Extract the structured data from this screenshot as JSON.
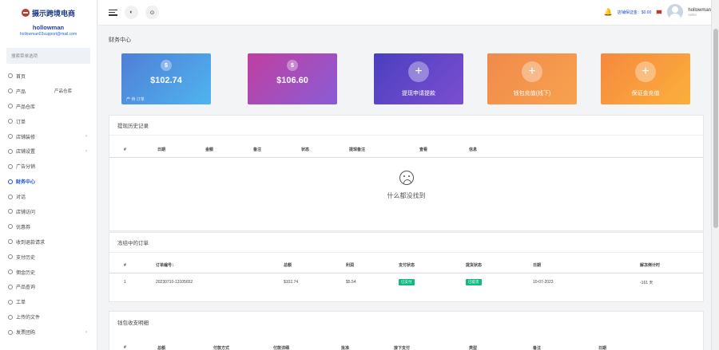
{
  "brand": {
    "logo_text": "摄示跨境电商"
  },
  "user": {
    "name": "hollowman",
    "email": "hollowman03support@mail.com",
    "role": "seller"
  },
  "search": {
    "placeholder": "搜索菜单选项"
  },
  "menu": [
    {
      "label": "首页"
    },
    {
      "label": "产品",
      "extra": "产品仓库"
    },
    {
      "label": "产品仓库"
    },
    {
      "label": "订单"
    },
    {
      "label": "店铺装修",
      "chevron": "›"
    },
    {
      "label": "店铺设置",
      "chevron": "›"
    },
    {
      "label": "广告分销"
    },
    {
      "label": "财务中心",
      "active": true
    },
    {
      "label": "对话"
    },
    {
      "label": "店铺访问"
    },
    {
      "label": "优惠券"
    },
    {
      "label": "收到退款请求"
    },
    {
      "label": "支付历史"
    },
    {
      "label": "佣金历史"
    },
    {
      "label": "产品查询"
    },
    {
      "label": "工单"
    },
    {
      "label": "上传的文件"
    },
    {
      "label": "发票团购",
      "chevron": "›"
    }
  ],
  "topbar": {
    "btn1": "◐",
    "btn2": "⊙",
    "bell": "🔔",
    "balance_label": "店铺保证金：$0.00"
  },
  "page": {
    "title": "财务中心"
  },
  "cards": [
    {
      "type": "coin",
      "icon": "$",
      "amount": "$102.74",
      "sub": "产   待 订单",
      "color1": "#4f7fd6",
      "color2": "#4fb4ef"
    },
    {
      "type": "coin",
      "icon": "$",
      "amount": "$106.60",
      "label": "",
      "color1": "#c03fa0",
      "color2": "#8a5cd6"
    },
    {
      "type": "plus",
      "icon": "+",
      "label": "提现申请提款",
      "color1": "#4a3fc0",
      "color2": "#7b4fd0"
    },
    {
      "type": "plus",
      "icon": "+",
      "label": "钱包充值(线下)",
      "color1": "#f08a4b",
      "color2": "#f7a24f"
    },
    {
      "type": "plus",
      "icon": "+",
      "label": "保证金充值",
      "color1": "#f6883f",
      "color2": "#fbb03b"
    }
  ],
  "withdraw": {
    "title": "提现历史记录",
    "headers": [
      "#",
      "日期",
      "金额",
      "备注",
      "状态",
      "提现备注",
      "查看",
      "信息"
    ],
    "empty": "什么都没找到"
  },
  "pending": {
    "title": "冻结中的订单",
    "headers": [
      "#",
      "订单编号：",
      "总额",
      "利润",
      "支付状态",
      "提货状态",
      "日期",
      "解冻倒计时"
    ],
    "rows": [
      {
        "idx": "1",
        "order_no": "20230710-13105652",
        "total": "$102.74",
        "profit": "$5.54",
        "pay_status": "已支付",
        "pick_status": "已提货",
        "date": "10-07-2023",
        "countdown": "-161 天"
      }
    ]
  },
  "wallet": {
    "title": "钱包收支明细",
    "headers": [
      "#",
      "总额",
      "付款方式",
      "付款详细",
      "批准",
      "接下支付",
      "类型",
      "备注",
      "日期"
    ]
  }
}
